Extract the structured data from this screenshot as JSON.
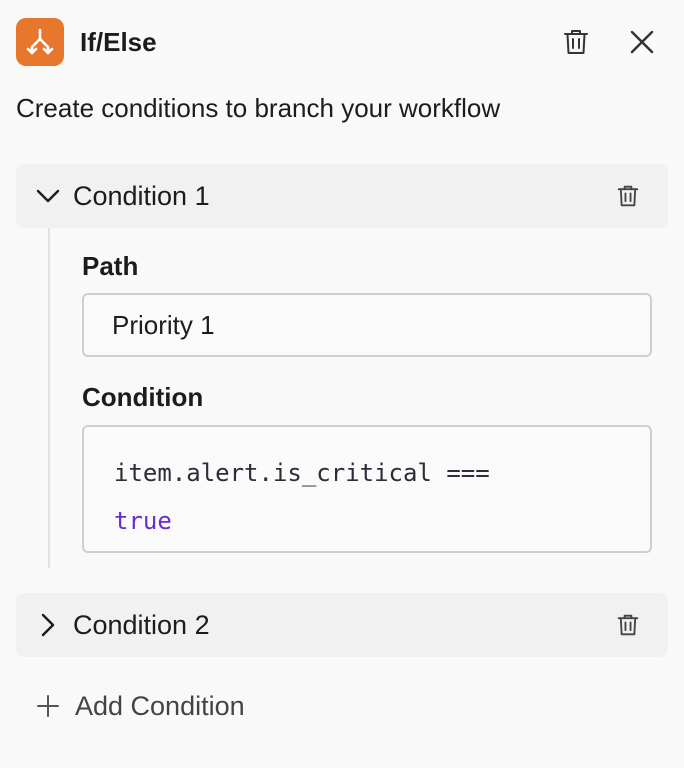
{
  "header": {
    "title": "If/Else",
    "icon": "branch-icon",
    "icon_bg": "#e8772e"
  },
  "description": "Create conditions to branch your workflow",
  "conditions": [
    {
      "label": "Condition 1",
      "expanded": true,
      "path_label": "Path",
      "path_value": "Priority 1",
      "condition_label": "Condition",
      "code_line1": "item.alert.is_critical ===",
      "code_line2": "true"
    },
    {
      "label": "Condition 2",
      "expanded": false
    }
  ],
  "add_condition_label": "Add Condition",
  "colors": {
    "keyword": "#6a2ec9",
    "accent": "#e8772e"
  }
}
